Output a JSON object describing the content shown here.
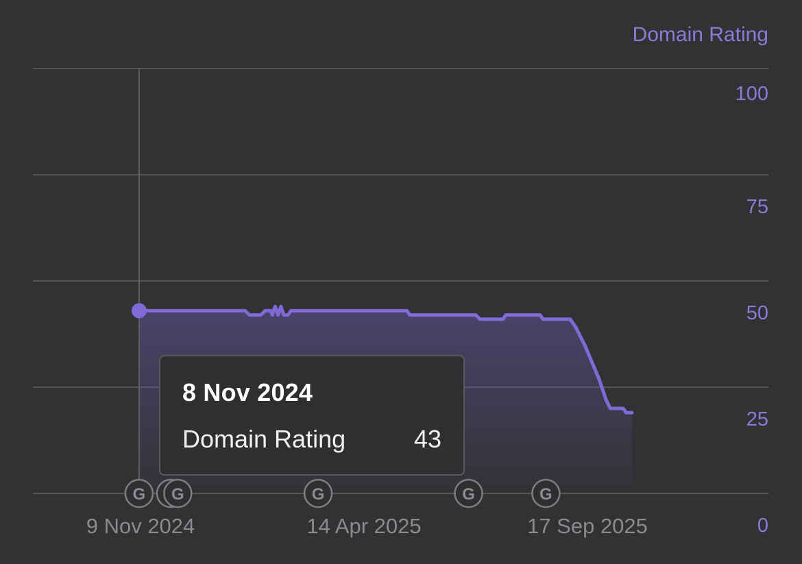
{
  "chart_data": {
    "type": "area",
    "y_axis_title": "Domain Rating",
    "ylim": [
      0,
      100
    ],
    "y_ticks": [
      "100",
      "75",
      "50",
      "25",
      "0"
    ],
    "y_tick_values": [
      100,
      75,
      50,
      25,
      0
    ],
    "x_tick_labels": [
      "9 Nov 2024",
      "14 Apr 2025",
      "17 Sep 2025"
    ],
    "x_tick_dates": [
      "2024-11-09",
      "2025-04-14",
      "2025-09-17"
    ],
    "grid": true,
    "series": [
      {
        "name": "Domain Rating",
        "color": "#7f6ad8",
        "points": [
          {
            "x": "2024-11-08",
            "y": 43
          },
          {
            "x": "2025-01-21",
            "y": 43
          },
          {
            "x": "2025-01-24",
            "y": 42
          },
          {
            "x": "2025-02-01",
            "y": 42
          },
          {
            "x": "2025-02-04",
            "y": 43
          },
          {
            "x": "2025-02-08",
            "y": 43
          },
          {
            "x": "2025-02-09",
            "y": 42
          },
          {
            "x": "2025-02-11",
            "y": 44
          },
          {
            "x": "2025-02-13",
            "y": 42
          },
          {
            "x": "2025-02-15",
            "y": 44
          },
          {
            "x": "2025-02-17",
            "y": 42
          },
          {
            "x": "2025-02-20",
            "y": 42
          },
          {
            "x": "2025-02-22",
            "y": 43
          },
          {
            "x": "2025-05-14",
            "y": 43
          },
          {
            "x": "2025-05-16",
            "y": 42
          },
          {
            "x": "2025-07-01",
            "y": 42
          },
          {
            "x": "2025-07-04",
            "y": 41
          },
          {
            "x": "2025-07-20",
            "y": 41
          },
          {
            "x": "2025-07-22",
            "y": 42
          },
          {
            "x": "2025-08-15",
            "y": 42
          },
          {
            "x": "2025-08-17",
            "y": 41
          },
          {
            "x": "2025-09-05",
            "y": 41
          },
          {
            "x": "2025-09-09",
            "y": 39
          },
          {
            "x": "2025-09-15",
            "y": 35
          },
          {
            "x": "2025-09-20",
            "y": 31
          },
          {
            "x": "2025-09-25",
            "y": 27
          },
          {
            "x": "2025-09-30",
            "y": 22
          },
          {
            "x": "2025-10-03",
            "y": 20
          },
          {
            "x": "2025-10-12",
            "y": 20
          },
          {
            "x": "2025-10-14",
            "y": 19
          },
          {
            "x": "2025-10-18",
            "y": 19
          }
        ]
      }
    ],
    "update_markers": [
      {
        "date": "2024-11-08",
        "label": "G"
      },
      {
        "date": "2024-11-30",
        "label": "G"
      },
      {
        "date": "2024-12-05",
        "label": "G"
      },
      {
        "date": "2025-03-13",
        "label": "G"
      },
      {
        "date": "2025-06-26",
        "label": "G"
      },
      {
        "date": "2025-08-19",
        "label": "G"
      }
    ],
    "tooltip": {
      "date": "8 Nov 2024",
      "label": "Domain Rating",
      "value": "43"
    }
  }
}
